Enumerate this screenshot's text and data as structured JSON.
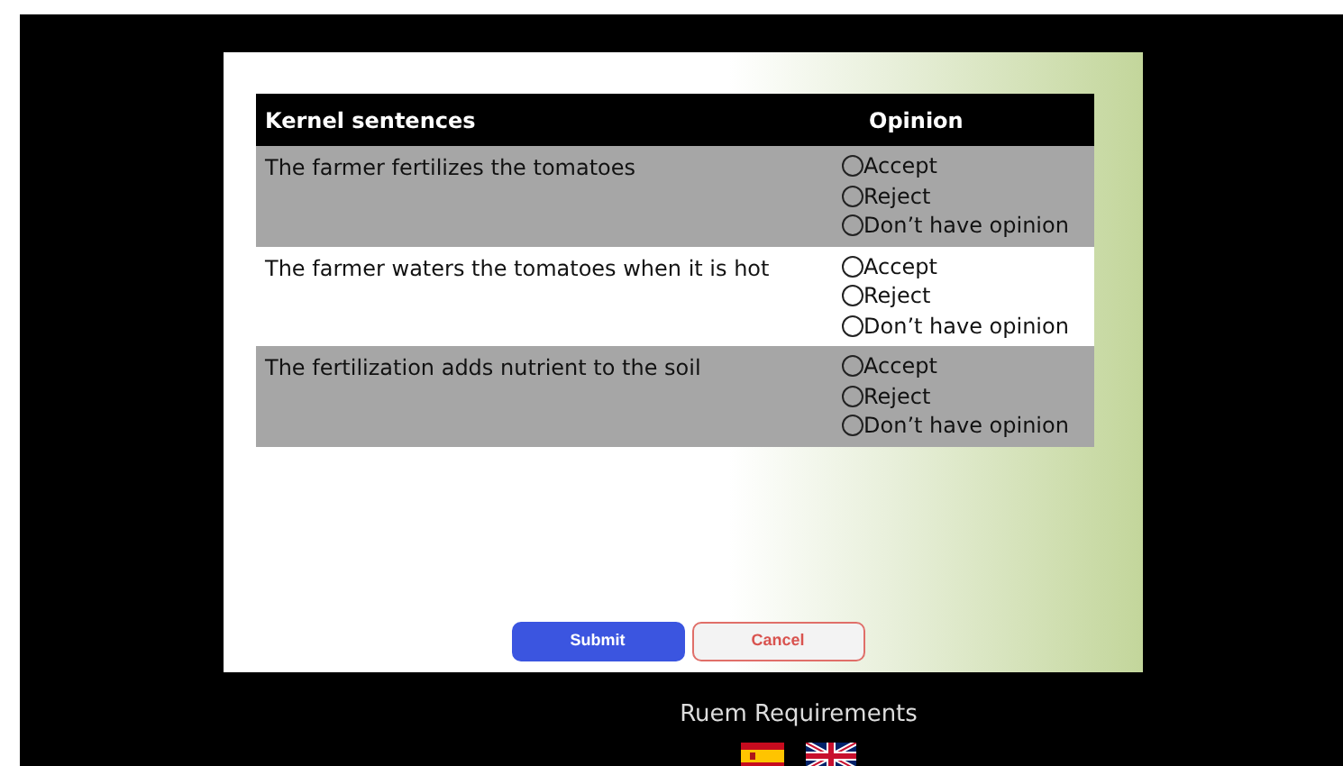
{
  "table": {
    "columns": [
      "Kernel sentences",
      "Opinion"
    ],
    "rows": [
      {
        "sentence": "The farmer fertilizes the tomatoes",
        "options": [
          {
            "label": "Accept",
            "selected": false
          },
          {
            "label": "Reject",
            "selected": false
          },
          {
            "label": "Don’t have opinion",
            "selected": false
          }
        ]
      },
      {
        "sentence": "The farmer waters the tomatoes when it is hot",
        "options": [
          {
            "label": "Accept",
            "selected": false
          },
          {
            "label": "Reject",
            "selected": false
          },
          {
            "label": "Don’t have opinion",
            "selected": false
          }
        ]
      },
      {
        "sentence": "The fertilization adds nutrient to the soil",
        "options": [
          {
            "label": "Accept",
            "selected": false
          },
          {
            "label": "Reject",
            "selected": false
          },
          {
            "label": "Don’t have opinion",
            "selected": false
          }
        ]
      }
    ]
  },
  "buttons": [
    {
      "label": "Submit",
      "kind": "primary"
    },
    {
      "label": "Cancel",
      "kind": "outline"
    }
  ],
  "footer": {
    "title": "Ruem Requirements"
  }
}
